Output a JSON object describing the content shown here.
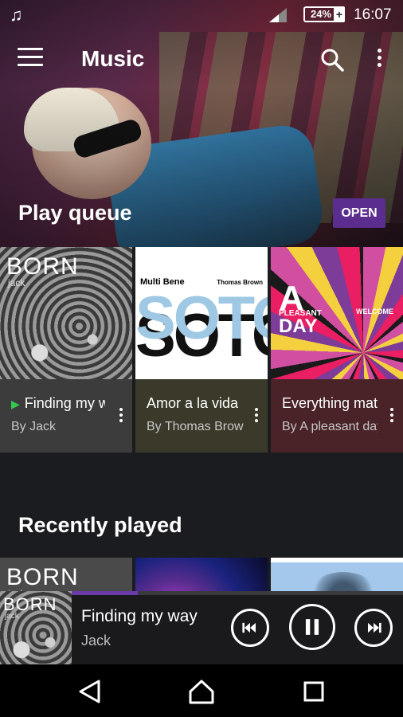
{
  "status_bar": {
    "battery": "24%",
    "charging": "+",
    "time": "16:07",
    "notification_icon": "music-note-icon"
  },
  "app_bar": {
    "title": "Music",
    "menu_icon": "hamburger-menu-icon",
    "search_icon": "search-icon",
    "more_icon": "more-vert-icon"
  },
  "play_queue": {
    "title": "Play queue",
    "open_label": "OPEN",
    "cards": [
      {
        "title": "Finding my way",
        "artist": "By Jack",
        "cover_title": "BORN",
        "cover_sub": "jack",
        "playing": true
      },
      {
        "title": "Amor a la vida",
        "artist": "By Thomas Brown",
        "cover_title": "SOTO",
        "cover_label": "Multi Bene",
        "cover_artist": "Thomas Brown",
        "playing": false
      },
      {
        "title": "Everything matters",
        "artist": "By A pleasant day",
        "cover_title": "A",
        "cover_sub": "PLEASANT",
        "cover_day": "DAY",
        "cover_tag": "WELCOME",
        "playing": false
      }
    ]
  },
  "recently_played": {
    "title": "Recently played",
    "thumbs": [
      {
        "cover_title": "BORN",
        "cover_sub": "jack"
      },
      {
        "cover_title": ""
      },
      {
        "cover_title": ""
      }
    ]
  },
  "player": {
    "song": "Finding my way",
    "artist": "Jack",
    "cover_title": "BORN",
    "cover_sub": "jack",
    "progress": 0.2,
    "accent": "#6a3aa8"
  },
  "colors": {
    "open_button": "#5b2d8e",
    "card1_bg": "#3c3c3c",
    "card2_bg": "#3b3a2a",
    "card3_bg": "#4a2328",
    "play_indicator": "#35c94f"
  }
}
